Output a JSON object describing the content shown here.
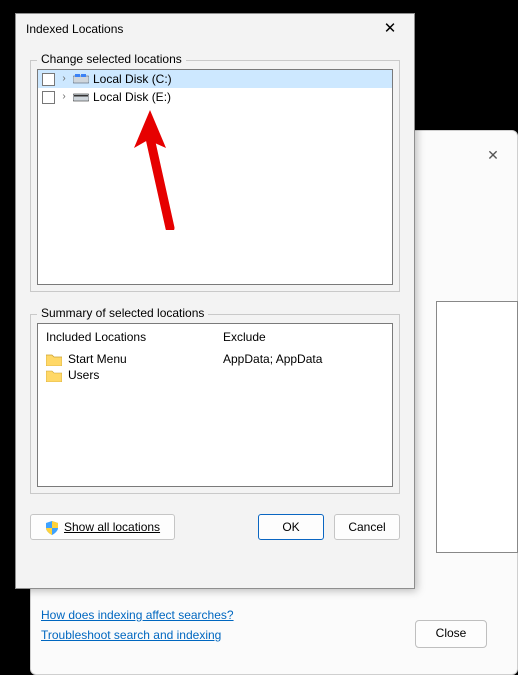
{
  "bg": {
    "link1": "How does indexing affect searches?",
    "link2": "Troubleshoot search and indexing",
    "close": "Close"
  },
  "dialog": {
    "title": "Indexed Locations",
    "change_label": "Change selected locations",
    "tree": [
      {
        "label": "Local Disk (C:)",
        "selected": true,
        "icon": "os"
      },
      {
        "label": "Local Disk (E:)",
        "selected": false,
        "icon": "hd"
      }
    ],
    "summary_label": "Summary of selected locations",
    "included_header": "Included Locations",
    "exclude_header": "Exclude",
    "included": [
      {
        "label": "Start Menu"
      },
      {
        "label": "Users"
      }
    ],
    "excluded_text": "AppData; AppData",
    "show_all": "Show all locations",
    "ok": "OK",
    "cancel": "Cancel"
  }
}
